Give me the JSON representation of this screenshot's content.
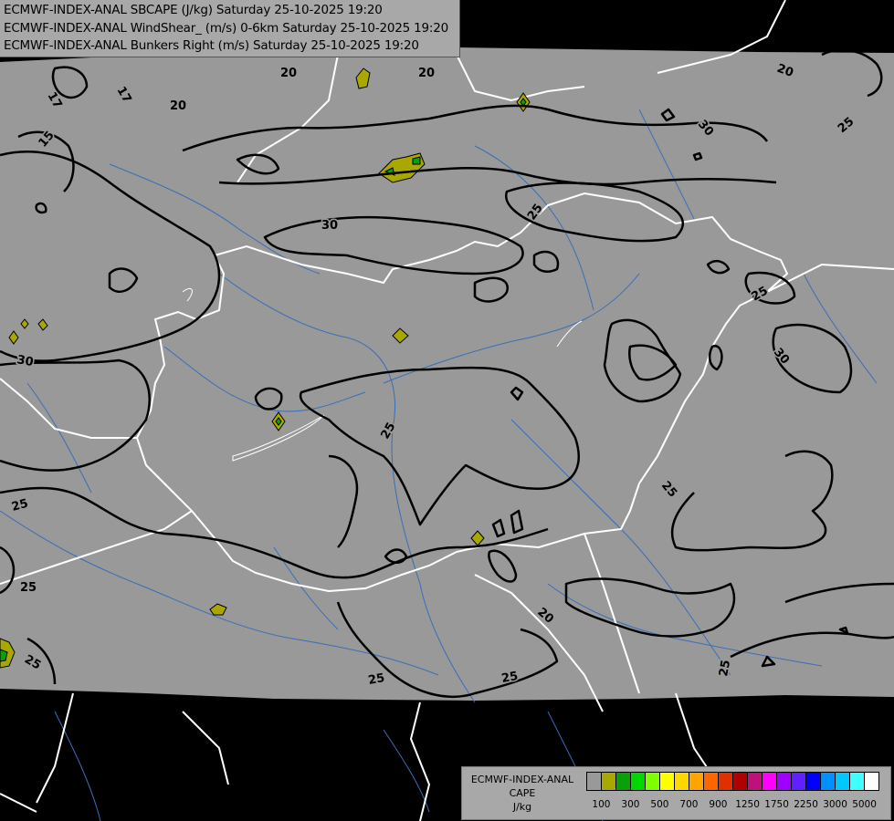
{
  "title_lines": [
    "ECMWF-INDEX-ANAL SBCAPE (J/kg) Saturday 25-10-2025 19:20",
    "ECMWF-INDEX-ANAL WindShear_ (m/s) 0-6km Saturday 25-10-2025 19:20",
    "ECMWF-INDEX-ANAL Bunkers Right (m/s) Saturday 25-10-2025 19:20"
  ],
  "legend": {
    "title_lines": [
      "ECMWF-INDEX-ANAL",
      "CAPE",
      "J/kg"
    ],
    "colors": [
      "#999999",
      "#a8a800",
      "#0aa00a",
      "#00d800",
      "#80ff00",
      "#ffff00",
      "#ffd700",
      "#ffa500",
      "#ff6600",
      "#e03000",
      "#b00000",
      "#c0107a",
      "#ff00ff",
      "#a000ff",
      "#6020ff",
      "#0000ff",
      "#0090ff",
      "#00c8ff",
      "#40ffff",
      "#ffffff"
    ],
    "tick_labels": [
      "100",
      "300",
      "500",
      "700",
      "900",
      "1250",
      "1750",
      "2250",
      "3000",
      "5000"
    ]
  },
  "contour_labels": [
    "17",
    "17",
    "20",
    "15",
    "20",
    "20",
    "20",
    "30",
    "25",
    "30",
    "30",
    "25",
    "30",
    "25",
    "25",
    "25",
    "25",
    "25",
    "25",
    "25",
    "20",
    "25",
    "25",
    "25"
  ],
  "colors": {
    "no_data": "#000000",
    "domain_fill": "#999999",
    "contour": "#000000",
    "borders": "#ffffff",
    "rivers": "#3a6eb8"
  }
}
